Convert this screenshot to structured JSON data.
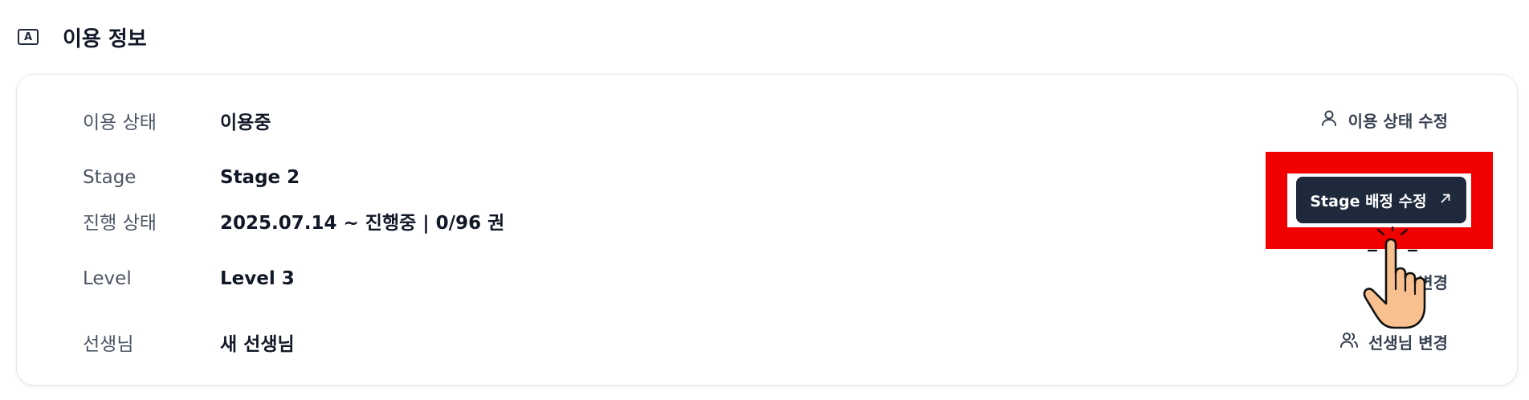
{
  "section": {
    "badge": "A",
    "title": "이용 정보"
  },
  "rows": [
    {
      "label": "이용 상태",
      "value": "이용중"
    },
    {
      "label": "Stage",
      "value": "Stage 2"
    },
    {
      "label": "진행 상태",
      "value": "2025.07.14 ~ 진행중 | 0/96 권"
    },
    {
      "label": "Level",
      "value": "Level 3"
    },
    {
      "label": "선생님",
      "value": "새 선생님"
    }
  ],
  "actions": {
    "status_edit": "이용 상태 수정",
    "stage_edit": "Stage 배정 수정",
    "level_change": "변경",
    "teacher_change": "선생님 변경"
  },
  "icons": {
    "status_edit": "user-icon",
    "stage_edit": "arrow-up-right-icon",
    "teacher_change": "users-icon",
    "cursor": "pointing-hand-cursor-icon"
  },
  "colors": {
    "highlight": "#f00000",
    "button_bg": "#1e293b",
    "label": "#4b5563"
  }
}
